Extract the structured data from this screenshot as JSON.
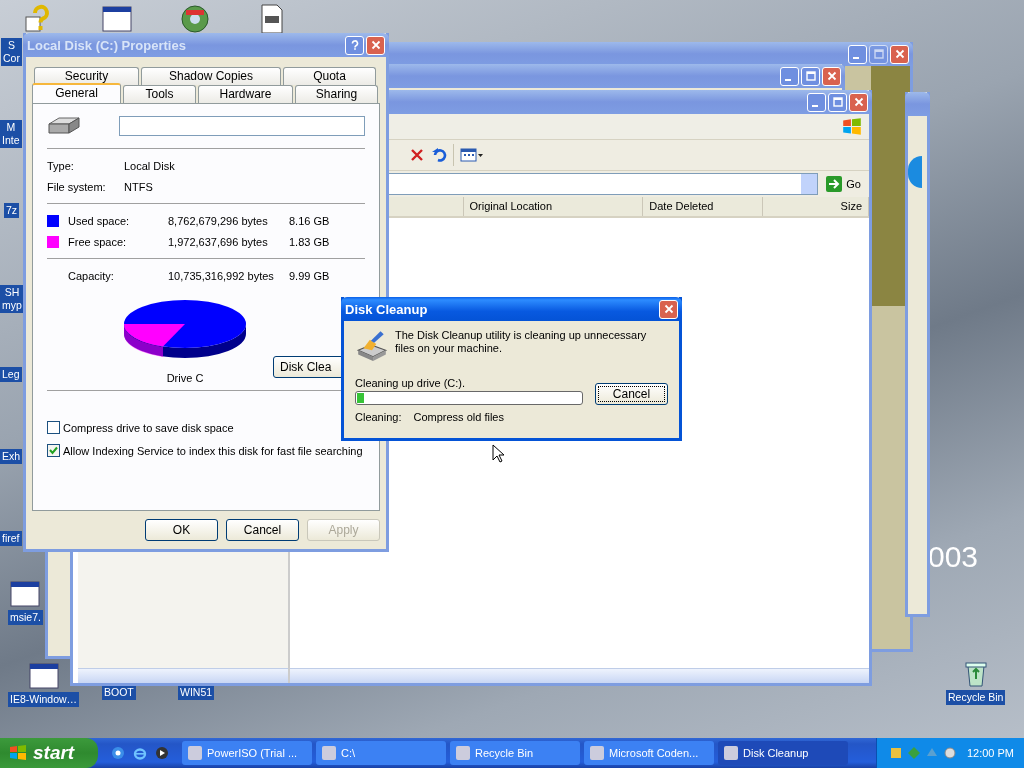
{
  "desktop": {
    "icons": [
      {
        "kind": "help"
      },
      {
        "kind": "window"
      },
      {
        "kind": "globe"
      },
      {
        "kind": "document"
      },
      {
        "kind": "none",
        "lines": [
          "S",
          "Cor"
        ]
      },
      {
        "kind": "none",
        "lines": [
          "M",
          "Inte"
        ]
      },
      {
        "kind": "none",
        "lines": [
          "7z"
        ]
      },
      {
        "kind": "none",
        "lines": [
          "SH",
          "myp"
        ]
      },
      {
        "kind": "none",
        "lines": [
          "Leg"
        ]
      },
      {
        "kind": "none",
        "lines": [
          "Exh"
        ]
      },
      {
        "kind": "none",
        "lines": [
          "firef"
        ]
      },
      {
        "kind": "window",
        "lines": [
          "msie7."
        ]
      },
      {
        "kind": "window",
        "lines": [
          "IE8-Window…"
        ]
      },
      {
        "kind": "none",
        "lines": [
          "BOOT"
        ]
      },
      {
        "kind": "none",
        "lines": [
          "WIN51"
        ]
      },
      {
        "kind": "recycle",
        "lines": [
          "Recycle Bin"
        ]
      }
    ],
    "wallpaper_text": "003"
  },
  "explorer": {
    "go_button": "Go",
    "columns": [
      "Original Location",
      "Date Deleted",
      "Size"
    ]
  },
  "properties": {
    "title": "Local Disk (C:) Properties",
    "tab_rows": [
      [
        {
          "label": "Security",
          "selected": false
        },
        {
          "label": "Shadow Copies",
          "selected": false
        },
        {
          "label": "Quota",
          "selected": false
        }
      ],
      [
        {
          "label": "General",
          "selected": true
        },
        {
          "label": "Tools",
          "selected": false
        },
        {
          "label": "Hardware",
          "selected": false
        },
        {
          "label": "Sharing",
          "selected": false
        }
      ]
    ],
    "info": [
      {
        "label": "Type:",
        "value": "Local Disk"
      },
      {
        "label": "File system:",
        "value": "NTFS"
      }
    ],
    "space": [
      {
        "label": "Used space:",
        "bytes": "8,762,679,296 bytes",
        "size": "8.16 GB",
        "color": "#0000ff"
      },
      {
        "label": "Free space:",
        "bytes": "1,972,637,696 bytes",
        "size": "1.83 GB",
        "color": "#ff00ff"
      }
    ],
    "capacity": {
      "label": "Capacity:",
      "bytes": "10,735,316,992 bytes",
      "size": "9.99 GB"
    },
    "drive_label": "Drive C",
    "cleanup_button": "Disk Clea",
    "options": [
      {
        "label": "Compress drive to save disk space",
        "checked": false
      },
      {
        "label": "Allow Indexing Service to index this disk for fast file searching",
        "checked": true
      }
    ],
    "buttons": [
      {
        "label": "OK",
        "disabled": false
      },
      {
        "label": "Cancel",
        "disabled": false
      },
      {
        "label": "Apply",
        "disabled": true
      }
    ]
  },
  "cleanup": {
    "title": "Disk Cleanup",
    "message": "The Disk Cleanup utility is cleaning up unnecessary files on your machine.",
    "drive_text": "Cleaning up drive  (C:).",
    "level": 0.03,
    "cancel": "Cancel",
    "status_label": "Cleaning:",
    "status_value": "Compress old files"
  },
  "taskbar": {
    "start": "start",
    "tasks": [
      {
        "label": "PowerISO (Trial ...",
        "selected": false
      },
      {
        "label": "C:\\",
        "selected": false
      },
      {
        "label": "Recycle Bin",
        "selected": false
      },
      {
        "label": "Microsoft Coden...",
        "selected": false
      },
      {
        "label": "Disk Cleanup",
        "selected": true
      }
    ],
    "clock": "12:00 PM"
  }
}
